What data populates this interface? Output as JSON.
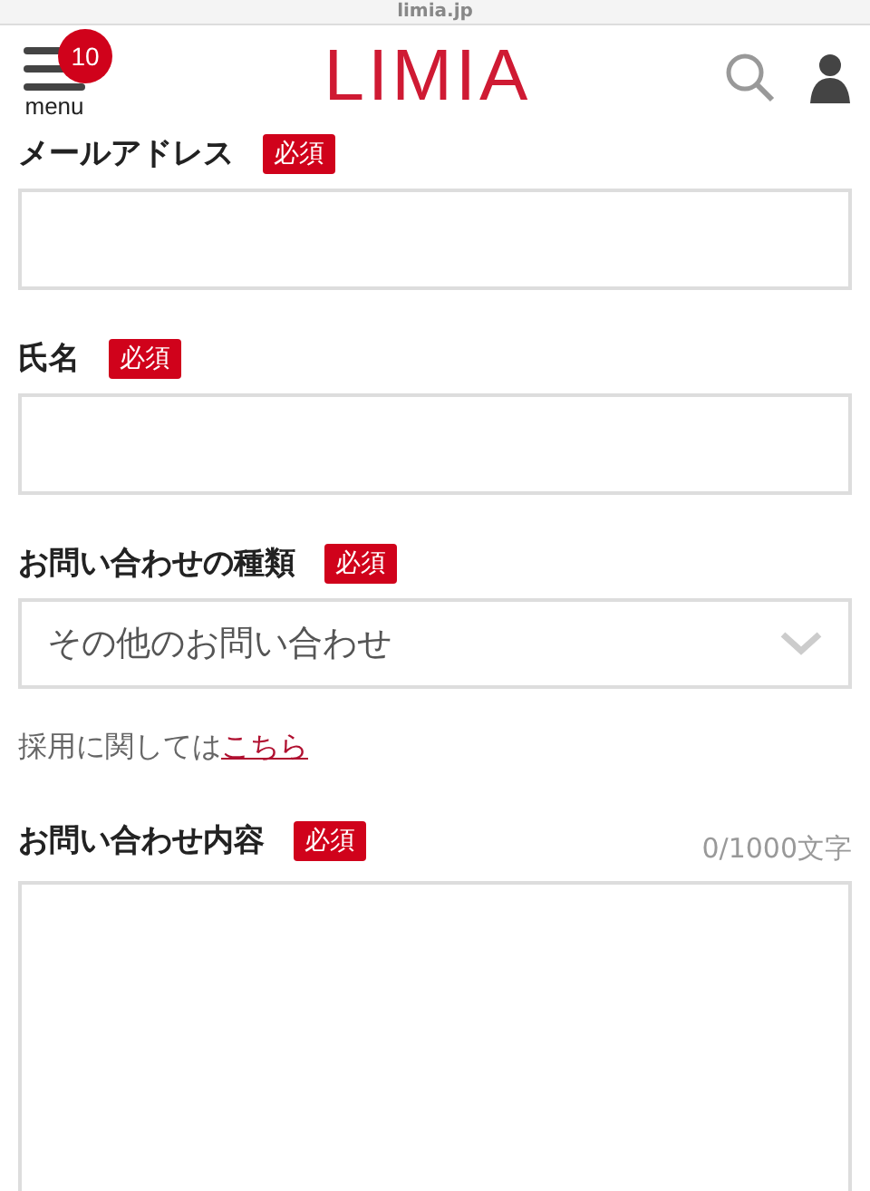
{
  "browser": {
    "url": "limia.jp"
  },
  "header": {
    "menu_label": "menu",
    "notification_count": "10",
    "logo": "LIMIA"
  },
  "fields": [
    {
      "kind": "text",
      "label": "メールアドレス",
      "required_badge": "必須"
    },
    {
      "kind": "text",
      "label": "氏名",
      "required_badge": "必須"
    },
    {
      "kind": "select",
      "label": "お問い合わせの種類",
      "required_badge": "必須",
      "value": "その他のお問い合わせ",
      "note": {
        "text": "採用に関しては",
        "link": "こちら"
      }
    },
    {
      "kind": "textarea",
      "label": "お問い合わせ内容",
      "required_badge": "必須",
      "counter": "0/1000文字"
    }
  ]
}
